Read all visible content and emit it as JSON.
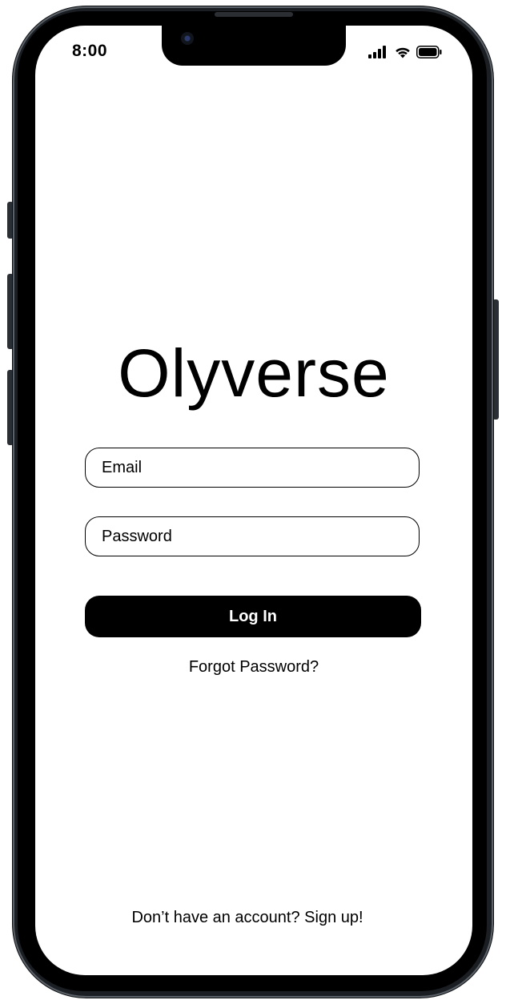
{
  "status_bar": {
    "time": "8:00",
    "icons": [
      "signal-icon",
      "wifi-icon",
      "battery-icon"
    ]
  },
  "app": {
    "title": "Olyverse"
  },
  "form": {
    "email_placeholder": "Email",
    "password_placeholder": "Password",
    "login_label": "Log In",
    "forgot_label": "Forgot Password?"
  },
  "footer": {
    "signup_label": "Don’t have an account? Sign up!"
  },
  "colors": {
    "primary": "#000000",
    "background": "#ffffff",
    "frame": "#1b1f23"
  }
}
